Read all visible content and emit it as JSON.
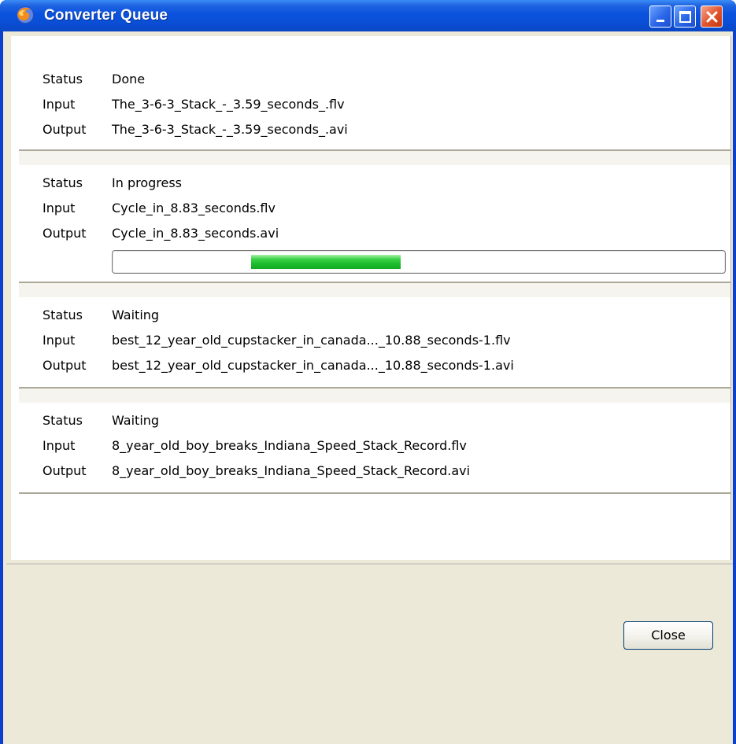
{
  "window": {
    "title": "Converter Queue",
    "icons": {
      "app": "firefox-icon",
      "minimize": "minimize-icon",
      "maximize": "maximize-icon",
      "close": "close-icon"
    }
  },
  "labels": {
    "status": "Status",
    "input": "Input",
    "output": "Output"
  },
  "queue": [
    {
      "status": "Done",
      "input": "The_3-6-3_Stack_-_3.59_seconds_.flv",
      "output": "The_3-6-3_Stack_-_3.59_seconds_.avi"
    },
    {
      "status": "In progress",
      "input": "Cycle_in_8.83_seconds.flv",
      "output": "Cycle_in_8.83_seconds.avi",
      "progress_indicator": "indeterminate"
    },
    {
      "status": "Waiting",
      "input": "best_12_year_old_cupstacker_in_canada..._10.88_seconds-1.flv",
      "output": "best_12_year_old_cupstacker_in_canada..._10.88_seconds-1.avi"
    },
    {
      "status": "Waiting",
      "input": "8_year_old_boy_breaks_Indiana_Speed_Stack_Record.flv",
      "output": "8_year_old_boy_breaks_Indiana_Speed_Stack_Record.avi"
    }
  ],
  "buttons": {
    "close": "Close"
  },
  "colors": {
    "titlebar": "#0a52de",
    "progress": "#1fbf2e",
    "dialog_bg": "#ece9d8"
  }
}
